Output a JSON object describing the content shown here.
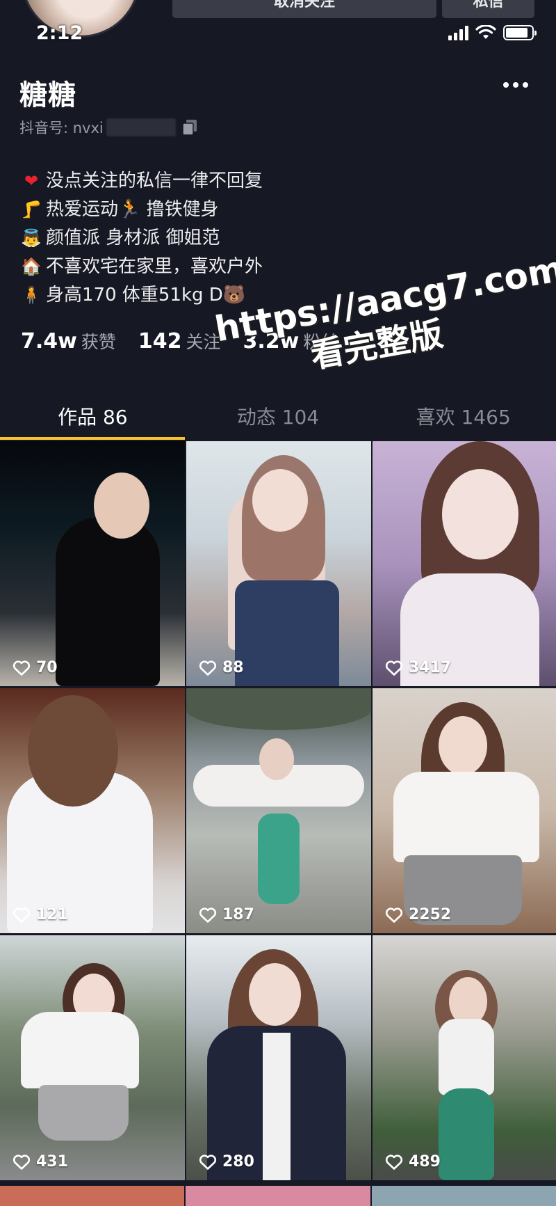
{
  "status_bar": {
    "time": "2:12",
    "battery_level": 0.85
  },
  "header": {
    "unfollow_label": "取消关注",
    "message_label": "私信",
    "username": "糖糖",
    "douyin_id_label": "抖音号: nvxi"
  },
  "bio": [
    {
      "icon": "heart-emoji",
      "glyph": "❤",
      "text": "没点关注的私信一律不回复"
    },
    {
      "icon": "leg-emoji",
      "glyph": "🦵",
      "text": "热爱运动🏃  撸铁健身"
    },
    {
      "icon": "angel-emoji",
      "glyph": "👼",
      "text": "颜值派 身材派 御姐范"
    },
    {
      "icon": "house-emoji",
      "glyph": "🏠",
      "text": "不喜欢宅在家里，喜欢户外"
    },
    {
      "icon": "person-emoji",
      "glyph": "🧍",
      "text": "身高170 体重51kg D🐻"
    }
  ],
  "stats": [
    {
      "value": "7.4w",
      "label": "获赞"
    },
    {
      "value": "142",
      "label": "关注"
    },
    {
      "value": "3.2w",
      "label": "粉丝"
    }
  ],
  "watermark": {
    "line1": "https://aacg7.com",
    "line2": "看完整版"
  },
  "tabs": [
    {
      "label": "作品 86",
      "active": true
    },
    {
      "label": "动态 104",
      "active": false
    },
    {
      "label": "喜欢 1465",
      "active": false
    }
  ],
  "videos": [
    {
      "likes": "70"
    },
    {
      "likes": "88"
    },
    {
      "likes": "3417"
    },
    {
      "likes": "121"
    },
    {
      "likes": "187"
    },
    {
      "likes": "2252"
    },
    {
      "likes": "431"
    },
    {
      "likes": "280"
    },
    {
      "likes": "489"
    }
  ],
  "colors": {
    "background": "#161823",
    "tab_indicator": "#f5c32c",
    "heart": "#e8232c"
  }
}
